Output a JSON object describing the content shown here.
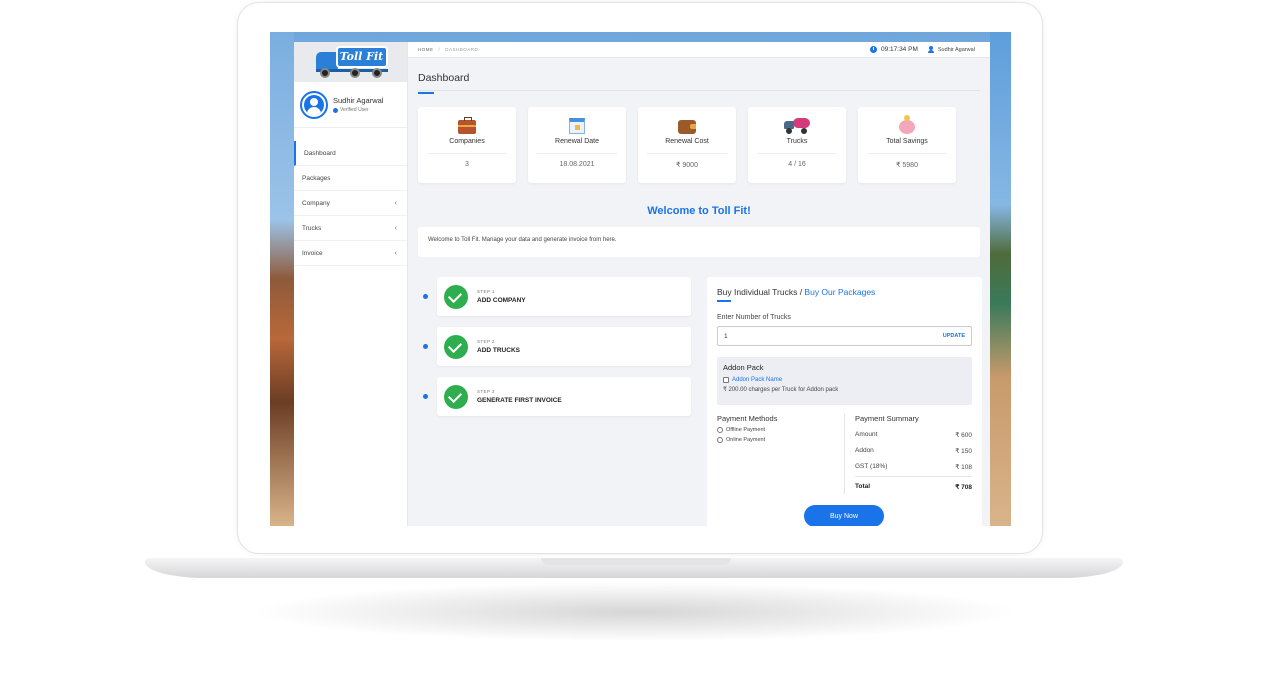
{
  "app": {
    "logo_text": "Toll Fit",
    "accent_color": "#1a73e8",
    "success_color": "#2eae4f"
  },
  "profile": {
    "name": "Sudhir Agarwal",
    "status": "Verified User"
  },
  "sidebar": {
    "items": [
      {
        "label": "Dashboard",
        "active": true,
        "has_chevron": false
      },
      {
        "label": "Packages",
        "active": false,
        "has_chevron": false
      },
      {
        "label": "Company",
        "active": false,
        "has_chevron": true
      },
      {
        "label": "Trucks",
        "active": false,
        "has_chevron": true
      },
      {
        "label": "Invoice",
        "active": false,
        "has_chevron": true
      }
    ],
    "chevron": "‹"
  },
  "topbar": {
    "breadcrumb_home": "HOME",
    "breadcrumb_sep": "/",
    "breadcrumb_current": "DASHBOARD",
    "time": "09:17:34 PM",
    "user": "Sudhir Agarwal"
  },
  "page": {
    "title": "Dashboard"
  },
  "stats": [
    {
      "label": "Companies",
      "value": "3",
      "icon": "briefcase-icon"
    },
    {
      "label": "Renewal Date",
      "value": "18.08.2021",
      "icon": "calendar-icon"
    },
    {
      "label": "Renewal Cost",
      "value": "₹ 9000",
      "icon": "wallet-icon"
    },
    {
      "label": "Trucks",
      "value": "4 / 16",
      "icon": "truck-icon"
    },
    {
      "label": "Total Savings",
      "value": "₹ 5980",
      "icon": "piggy-bank-icon"
    }
  ],
  "welcome": {
    "title": "Welcome to Toll Fit!",
    "message": "Welcome to Toll Fit. Manage your data and generate invoice from here."
  },
  "steps": [
    {
      "number": "STEP 1",
      "title": "ADD COMPANY"
    },
    {
      "number": "STEP 2",
      "title": "ADD TRUCKS"
    },
    {
      "number": "STEP 3",
      "title": "GENERATE FIRST INVOICE"
    }
  ],
  "buy": {
    "heading": "Buy Individual Trucks",
    "heading_sep": " / ",
    "packages_link": "Buy Our Packages",
    "trucks_label": "Enter Number of Trucks",
    "trucks_value": "1",
    "update_label": "UPDATE",
    "addon_title": "Addon Pack",
    "addon_name": "Addon Pack Name",
    "addon_charge": "₹ 200.00 charges per Truck for Addon pack",
    "payment_methods_title": "Payment Methods",
    "payment_options": [
      "Offline Payment",
      "Online Payment"
    ],
    "summary_title": "Payment Summary",
    "summary": [
      {
        "label": "Amount",
        "value": "₹ 600"
      },
      {
        "label": "Addon",
        "value": "₹ 150"
      },
      {
        "label": "GST (18%)",
        "value": "₹ 108"
      }
    ],
    "total_label": "Total",
    "total_value": "₹ 708",
    "buy_now_label": "Buy Now"
  }
}
